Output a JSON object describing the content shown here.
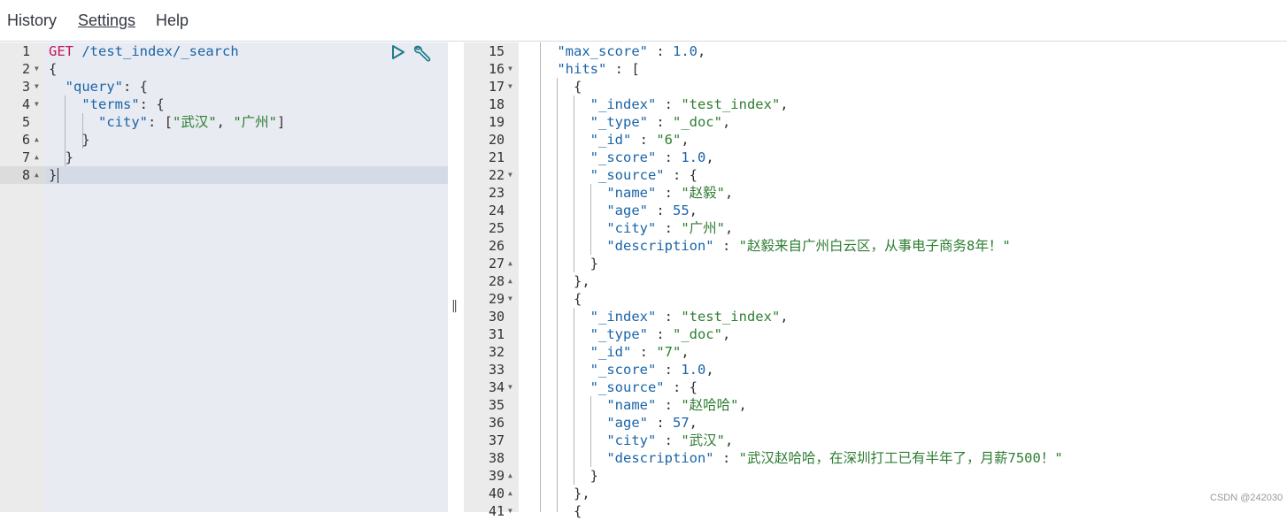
{
  "menu": {
    "history": "History",
    "settings": "Settings",
    "help": "Help"
  },
  "request": {
    "lines": [
      {
        "num": "1",
        "fold": "",
        "tokens": [
          {
            "c": "m",
            "t": "GET"
          },
          {
            "c": "p",
            "t": " "
          },
          {
            "c": "u",
            "t": "/test_index/_search"
          }
        ]
      },
      {
        "num": "2",
        "fold": "down",
        "tokens": [
          {
            "c": "p",
            "t": "{"
          }
        ]
      },
      {
        "num": "3",
        "fold": "down",
        "tokens": [
          {
            "c": "p",
            "t": "  "
          },
          {
            "c": "k",
            "t": "\"query\""
          },
          {
            "c": "p",
            "t": ": {"
          }
        ]
      },
      {
        "num": "4",
        "fold": "down",
        "tokens": [
          {
            "c": "p",
            "t": "    "
          },
          {
            "c": "k",
            "t": "\"terms\""
          },
          {
            "c": "p",
            "t": ": {"
          }
        ]
      },
      {
        "num": "5",
        "fold": "",
        "tokens": [
          {
            "c": "p",
            "t": "      "
          },
          {
            "c": "k",
            "t": "\"city\""
          },
          {
            "c": "p",
            "t": ": ["
          },
          {
            "c": "s",
            "t": "\"武汉\""
          },
          {
            "c": "p",
            "t": ", "
          },
          {
            "c": "s",
            "t": "\"广州\""
          },
          {
            "c": "p",
            "t": "]"
          }
        ]
      },
      {
        "num": "6",
        "fold": "up",
        "tokens": [
          {
            "c": "p",
            "t": "    }"
          }
        ]
      },
      {
        "num": "7",
        "fold": "up",
        "tokens": [
          {
            "c": "p",
            "t": "  }"
          }
        ]
      },
      {
        "num": "8",
        "fold": "up",
        "tokens": [
          {
            "c": "p",
            "t": "}"
          }
        ]
      }
    ]
  },
  "response": {
    "lines": [
      {
        "num": "15",
        "fold": "",
        "tokens": [
          {
            "c": "p",
            "t": "    "
          },
          {
            "c": "k",
            "t": "\"max_score\""
          },
          {
            "c": "p",
            "t": " : "
          },
          {
            "c": "n",
            "t": "1.0"
          },
          {
            "c": "p",
            "t": ","
          }
        ]
      },
      {
        "num": "16",
        "fold": "down",
        "tokens": [
          {
            "c": "p",
            "t": "    "
          },
          {
            "c": "k",
            "t": "\"hits\""
          },
          {
            "c": "p",
            "t": " : ["
          }
        ]
      },
      {
        "num": "17",
        "fold": "down",
        "tokens": [
          {
            "c": "p",
            "t": "      {"
          }
        ]
      },
      {
        "num": "18",
        "fold": "",
        "tokens": [
          {
            "c": "p",
            "t": "        "
          },
          {
            "c": "k",
            "t": "\"_index\""
          },
          {
            "c": "p",
            "t": " : "
          },
          {
            "c": "s",
            "t": "\"test_index\""
          },
          {
            "c": "p",
            "t": ","
          }
        ]
      },
      {
        "num": "19",
        "fold": "",
        "tokens": [
          {
            "c": "p",
            "t": "        "
          },
          {
            "c": "k",
            "t": "\"_type\""
          },
          {
            "c": "p",
            "t": " : "
          },
          {
            "c": "s",
            "t": "\"_doc\""
          },
          {
            "c": "p",
            "t": ","
          }
        ]
      },
      {
        "num": "20",
        "fold": "",
        "tokens": [
          {
            "c": "p",
            "t": "        "
          },
          {
            "c": "k",
            "t": "\"_id\""
          },
          {
            "c": "p",
            "t": " : "
          },
          {
            "c": "s",
            "t": "\"6\""
          },
          {
            "c": "p",
            "t": ","
          }
        ]
      },
      {
        "num": "21",
        "fold": "",
        "tokens": [
          {
            "c": "p",
            "t": "        "
          },
          {
            "c": "k",
            "t": "\"_score\""
          },
          {
            "c": "p",
            "t": " : "
          },
          {
            "c": "n",
            "t": "1.0"
          },
          {
            "c": "p",
            "t": ","
          }
        ]
      },
      {
        "num": "22",
        "fold": "down",
        "tokens": [
          {
            "c": "p",
            "t": "        "
          },
          {
            "c": "k",
            "t": "\"_source\""
          },
          {
            "c": "p",
            "t": " : {"
          }
        ]
      },
      {
        "num": "23",
        "fold": "",
        "tokens": [
          {
            "c": "p",
            "t": "          "
          },
          {
            "c": "k",
            "t": "\"name\""
          },
          {
            "c": "p",
            "t": " : "
          },
          {
            "c": "s",
            "t": "\"赵毅\""
          },
          {
            "c": "p",
            "t": ","
          }
        ]
      },
      {
        "num": "24",
        "fold": "",
        "tokens": [
          {
            "c": "p",
            "t": "          "
          },
          {
            "c": "k",
            "t": "\"age\""
          },
          {
            "c": "p",
            "t": " : "
          },
          {
            "c": "n",
            "t": "55"
          },
          {
            "c": "p",
            "t": ","
          }
        ]
      },
      {
        "num": "25",
        "fold": "",
        "tokens": [
          {
            "c": "p",
            "t": "          "
          },
          {
            "c": "k",
            "t": "\"city\""
          },
          {
            "c": "p",
            "t": " : "
          },
          {
            "c": "s",
            "t": "\"广州\""
          },
          {
            "c": "p",
            "t": ","
          }
        ]
      },
      {
        "num": "26",
        "fold": "",
        "tokens": [
          {
            "c": "p",
            "t": "          "
          },
          {
            "c": "k",
            "t": "\"description\""
          },
          {
            "c": "p",
            "t": " : "
          },
          {
            "c": "s",
            "t": "\"赵毅来自广州白云区，从事电子商务8年！\""
          }
        ]
      },
      {
        "num": "27",
        "fold": "up",
        "tokens": [
          {
            "c": "p",
            "t": "        }"
          }
        ]
      },
      {
        "num": "28",
        "fold": "up",
        "tokens": [
          {
            "c": "p",
            "t": "      },"
          }
        ]
      },
      {
        "num": "29",
        "fold": "down",
        "tokens": [
          {
            "c": "p",
            "t": "      {"
          }
        ]
      },
      {
        "num": "30",
        "fold": "",
        "tokens": [
          {
            "c": "p",
            "t": "        "
          },
          {
            "c": "k",
            "t": "\"_index\""
          },
          {
            "c": "p",
            "t": " : "
          },
          {
            "c": "s",
            "t": "\"test_index\""
          },
          {
            "c": "p",
            "t": ","
          }
        ]
      },
      {
        "num": "31",
        "fold": "",
        "tokens": [
          {
            "c": "p",
            "t": "        "
          },
          {
            "c": "k",
            "t": "\"_type\""
          },
          {
            "c": "p",
            "t": " : "
          },
          {
            "c": "s",
            "t": "\"_doc\""
          },
          {
            "c": "p",
            "t": ","
          }
        ]
      },
      {
        "num": "32",
        "fold": "",
        "tokens": [
          {
            "c": "p",
            "t": "        "
          },
          {
            "c": "k",
            "t": "\"_id\""
          },
          {
            "c": "p",
            "t": " : "
          },
          {
            "c": "s",
            "t": "\"7\""
          },
          {
            "c": "p",
            "t": ","
          }
        ]
      },
      {
        "num": "33",
        "fold": "",
        "tokens": [
          {
            "c": "p",
            "t": "        "
          },
          {
            "c": "k",
            "t": "\"_score\""
          },
          {
            "c": "p",
            "t": " : "
          },
          {
            "c": "n",
            "t": "1.0"
          },
          {
            "c": "p",
            "t": ","
          }
        ]
      },
      {
        "num": "34",
        "fold": "down",
        "tokens": [
          {
            "c": "p",
            "t": "        "
          },
          {
            "c": "k",
            "t": "\"_source\""
          },
          {
            "c": "p",
            "t": " : {"
          }
        ]
      },
      {
        "num": "35",
        "fold": "",
        "tokens": [
          {
            "c": "p",
            "t": "          "
          },
          {
            "c": "k",
            "t": "\"name\""
          },
          {
            "c": "p",
            "t": " : "
          },
          {
            "c": "s",
            "t": "\"赵哈哈\""
          },
          {
            "c": "p",
            "t": ","
          }
        ]
      },
      {
        "num": "36",
        "fold": "",
        "tokens": [
          {
            "c": "p",
            "t": "          "
          },
          {
            "c": "k",
            "t": "\"age\""
          },
          {
            "c": "p",
            "t": " : "
          },
          {
            "c": "n",
            "t": "57"
          },
          {
            "c": "p",
            "t": ","
          }
        ]
      },
      {
        "num": "37",
        "fold": "",
        "tokens": [
          {
            "c": "p",
            "t": "          "
          },
          {
            "c": "k",
            "t": "\"city\""
          },
          {
            "c": "p",
            "t": " : "
          },
          {
            "c": "s",
            "t": "\"武汉\""
          },
          {
            "c": "p",
            "t": ","
          }
        ]
      },
      {
        "num": "38",
        "fold": "",
        "tokens": [
          {
            "c": "p",
            "t": "          "
          },
          {
            "c": "k",
            "t": "\"description\""
          },
          {
            "c": "p",
            "t": " : "
          },
          {
            "c": "s",
            "t": "\"武汉赵哈哈，在深圳打工已有半年了，月薪7500！\""
          }
        ]
      },
      {
        "num": "39",
        "fold": "up",
        "tokens": [
          {
            "c": "p",
            "t": "        }"
          }
        ]
      },
      {
        "num": "40",
        "fold": "up",
        "tokens": [
          {
            "c": "p",
            "t": "      },"
          }
        ]
      },
      {
        "num": "41",
        "fold": "down",
        "tokens": [
          {
            "c": "p",
            "t": "      {"
          }
        ]
      }
    ]
  },
  "watermark": "CSDN @242030",
  "splitter_glyph": "‖",
  "colors": {
    "key": "#1b65a8",
    "string": "#2e7d32",
    "method": "#c2185b",
    "active_line": "#d5dbe6"
  }
}
